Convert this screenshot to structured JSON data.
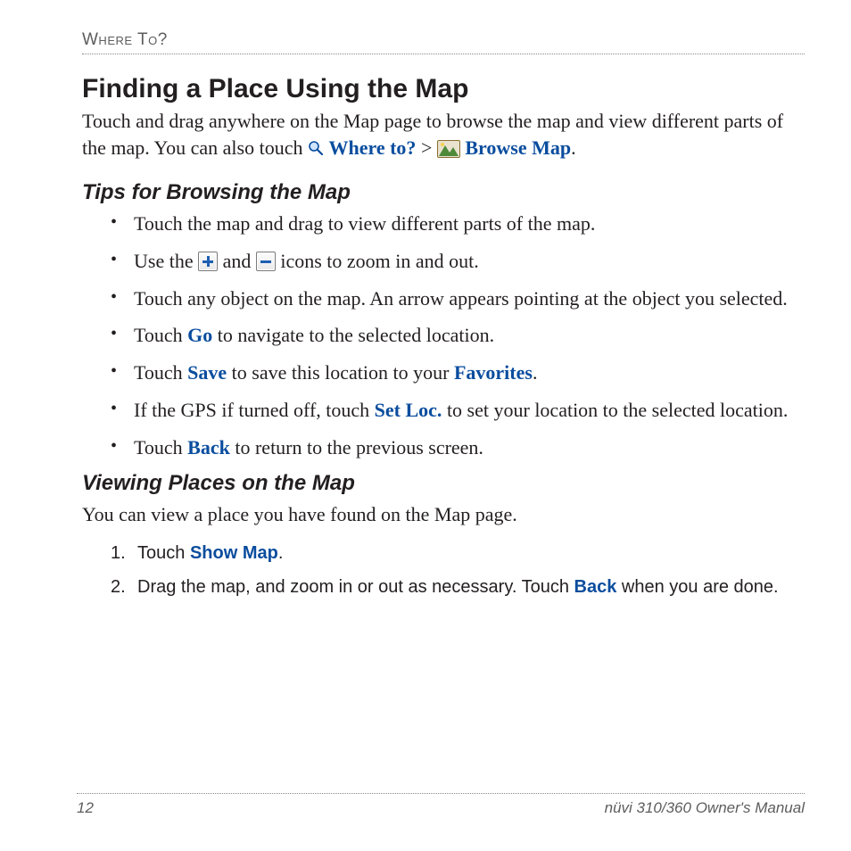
{
  "header": {
    "running_head": "Where To?"
  },
  "main": {
    "heading": "Finding a Place Using the Map",
    "intro": {
      "pre": "Touch and drag anywhere on the Map page to browse the map and view different parts of the map. You can also touch ",
      "where_to": "Where to?",
      "gt": " > ",
      "browse_map": "Browse Map",
      "end": "."
    },
    "tips": {
      "heading": "Tips for Browsing the Map",
      "items": {
        "i0": "Touch the map and drag to view different parts of the map.",
        "i1": {
          "a": "Use the ",
          "b": " and ",
          "c": " icons to zoom in and out."
        },
        "i2": "Touch any object on the map. An arrow appears pointing at the object you selected.",
        "i3": {
          "a": "Touch ",
          "go": "Go",
          "b": " to navigate to the selected location."
        },
        "i4": {
          "a": "Touch ",
          "save": "Save",
          "b": " to save this location to your ",
          "fav": "Favorites",
          "c": "."
        },
        "i5": {
          "a": "If the GPS if turned off, touch ",
          "setloc": "Set Loc.",
          "b": " to set your location to the selected location."
        },
        "i6": {
          "a": "Touch ",
          "back": "Back",
          "b": " to return to the previous screen."
        }
      }
    },
    "viewing": {
      "heading": "Viewing Places on the Map",
      "para": "You can view a place you have found on the Map page.",
      "steps": {
        "s1": {
          "a": "Touch ",
          "cmd": "Show Map",
          "b": "."
        },
        "s2": {
          "a": "Drag the map, and zoom in or out as necessary. Touch ",
          "cmd": "Back",
          "b": " when you are done."
        }
      }
    }
  },
  "footer": {
    "page": "12",
    "manual": "nüvi 310/360 Owner's Manual"
  }
}
